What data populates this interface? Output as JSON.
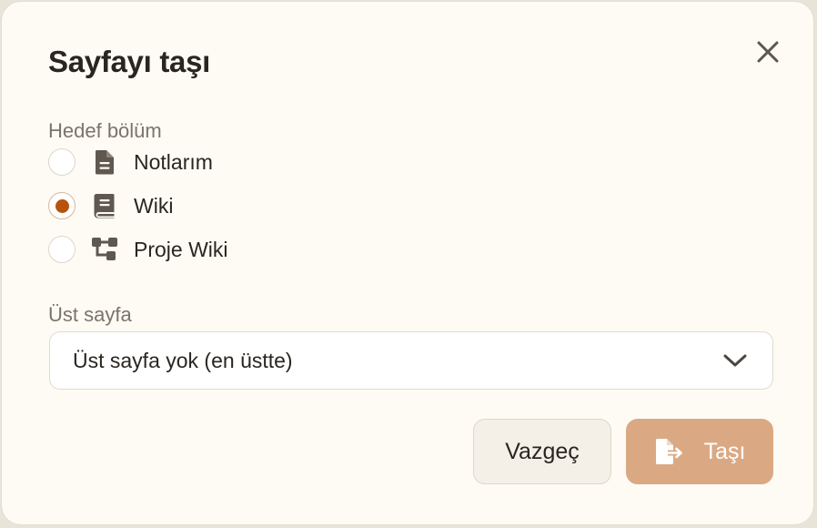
{
  "dialog": {
    "title": "Sayfayı taşı",
    "close_icon": "close-icon"
  },
  "target_section": {
    "label": "Hedef bölüm",
    "options": [
      {
        "label": "Notlarım",
        "icon": "document-icon",
        "checked": false
      },
      {
        "label": "Wiki",
        "icon": "book-icon",
        "checked": true
      },
      {
        "label": "Proje Wiki",
        "icon": "hierarchy-icon",
        "checked": false
      }
    ]
  },
  "parent_page": {
    "label": "Üst sayfa",
    "selected": "Üst sayfa yok (en üstte)",
    "icon": "chevron-down-icon"
  },
  "actions": {
    "cancel_label": "Vazgeç",
    "move_label": "Taşı",
    "move_icon": "file-export-icon"
  },
  "colors": {
    "accent": "#b8530e",
    "primary_button": "#daa983",
    "background": "#fdfbf4"
  }
}
